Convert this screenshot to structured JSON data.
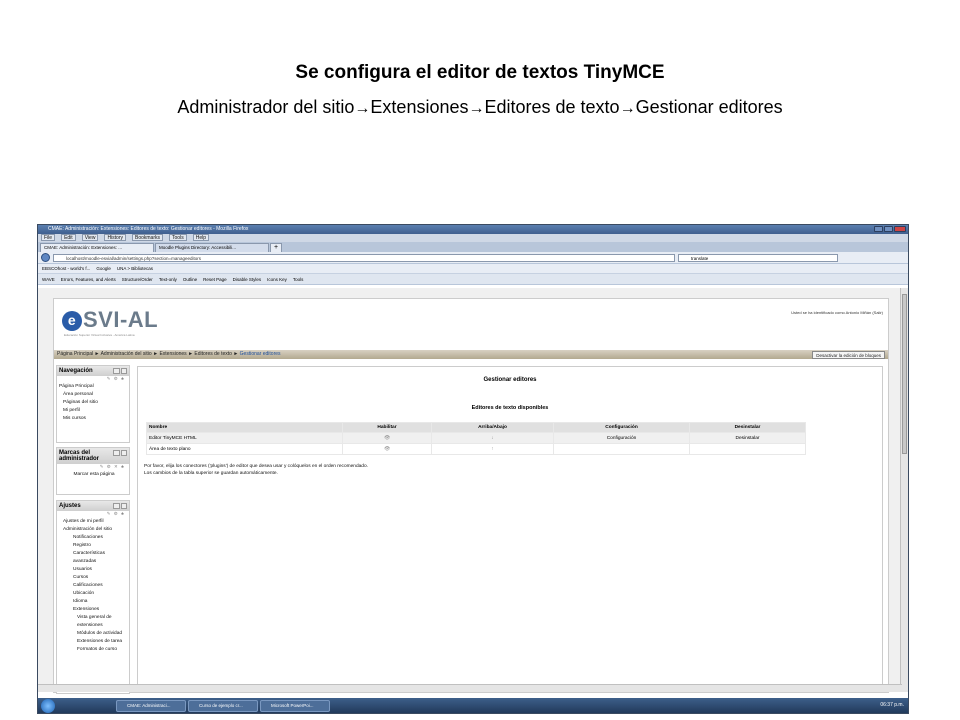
{
  "slide": {
    "title": "Se configura el editor de textos TinyMCE",
    "path": [
      "Administrador del sitio",
      "Extensiones",
      "Editores de texto",
      "Gestionar editores"
    ],
    "arrow": "→"
  },
  "browser": {
    "window_title": "CMAE: Administración: Extensiones: Editores de texto: Gestionar editores - Mozilla Firefox",
    "menu": [
      "File",
      "Edit",
      "View",
      "History",
      "Bookmarks",
      "Tools",
      "Help"
    ],
    "tabs": [
      "CMAE: Administración: Extensiones: ...",
      "Moodle Plugins Directory: Accessibili..."
    ],
    "new_tab": "+",
    "url": "localhost/moodle-esvial/admin/settings.php?section=manageeditors",
    "search": "translate",
    "bookmarks": [
      "EBSCOhost - world's f...",
      "Google",
      "UNA > Bibliotecas"
    ],
    "wave_toolbar": [
      "WAVE",
      "Errors, Features, and Alerts",
      "Structure/Order",
      "Text-only",
      "Outline",
      "Reset Page",
      "Disable Styles",
      "Icons Key",
      "Tools"
    ]
  },
  "moodle": {
    "logo": "SVI-AL",
    "logo_letter": "e",
    "logo_sub": "Educación Superior Virtual Inclusiva - América Latina",
    "user_info": "Usted se ha identificado como Antonio Miñán (Salir)",
    "breadcrumb": "Página Principal ► Administración del sitio ► Extensiones ► Editores de texto ► ",
    "breadcrumb_current": "Gestionar editores",
    "blocks_button": "Desactivar la edición de bloques",
    "nav": {
      "title": "Navegación",
      "items": [
        "Página Principal",
        "Área personal",
        "Páginas del sitio",
        "Mi perfil",
        "Mis cursos"
      ]
    },
    "marks": {
      "title": "Marcas del administrador",
      "items": [
        "Marcar esta página"
      ]
    },
    "settings": {
      "title": "Ajustes",
      "items": [
        "Ajustes de mi perfil",
        "Administración del sitio",
        "Notificaciones",
        "Registro",
        "Características avanzadas",
        "Usuarios",
        "Cursos",
        "Calificaciones",
        "Ubicación",
        "Idioma",
        "Extensiones",
        "Vista general de extensiones",
        "Módulos de actividad",
        "Extensiones de tarea",
        "Formatos de curso"
      ]
    },
    "main": {
      "title": "Gestionar editores",
      "subtitle": "Editores de texto disponibles",
      "columns": [
        "Nombre",
        "Habilitar",
        "Arriba/Abajo",
        "Configuración",
        "Desinstalar"
      ],
      "rows": [
        [
          "Editor TinyMCE HTML",
          "👁",
          "↓",
          "Configuración",
          "Desinstalar"
        ],
        [
          "Área de texto plano",
          "👁",
          "↑",
          "",
          ""
        ]
      ],
      "note1": "Por favor, elija los conectores ('plugins') de editor que desea usar y colóquelos en el orden recomendado.",
      "note2": "Los cambios de la tabla superior se guardan automáticamente."
    }
  },
  "taskbar": {
    "items": [
      "CMAE: Administraci...",
      "Curso de ejemplo cr...",
      "Microsoft PowerPoi..."
    ],
    "clock": "06:37 p.m."
  }
}
